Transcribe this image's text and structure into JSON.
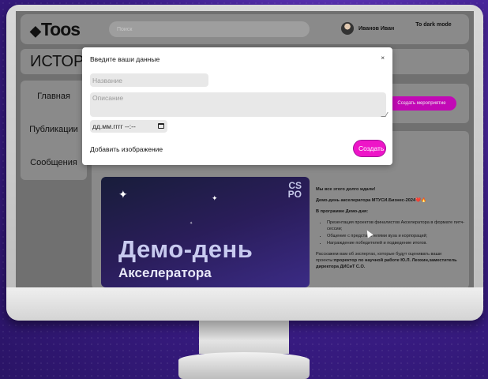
{
  "header": {
    "logo": "Toos",
    "logo_mark": "◆",
    "search_placeholder": "Поиск",
    "user_name": "Иванов Иван",
    "dark_mode_label": "To dark mode"
  },
  "page": {
    "title": "ИСТОРИ"
  },
  "sidebar": {
    "items": [
      {
        "label": "Главная"
      },
      {
        "label": "Публикации"
      },
      {
        "label": "Сообщения"
      }
    ]
  },
  "right_panel": {
    "create_post_label": "Создать мероприятие"
  },
  "post": {
    "image": {
      "corner_mark_line1": "CS",
      "corner_mark_line2": "PO",
      "title": "Демо-день",
      "subtitle": "Акселератора"
    },
    "text": {
      "intro": "Мы все этого долго ждали!",
      "headline": "Демо-день акселератора МТУСИ.Бизнес-2024❤️🔥",
      "program_heading": "В программе Демо-дня:",
      "program_items": [
        "Презентация проектов финалистов Акселератора в формате питч-сессии;",
        "Общение с представителями вуза и корпораций;",
        "Награждение победителей и подведение итогов."
      ],
      "experts_text": "Расскажем вам об экспертах, которые будут оценивать ваши проекты:",
      "expert_bold": "проректор по научной работе Ю.Л. Леохин,заместитель директора ДИСиТ С.О."
    }
  },
  "modal": {
    "title": "Введите ваши данные",
    "close_label": "×",
    "name_placeholder": "Название",
    "description_placeholder": "Описание",
    "date_value": "дд.мм.гггг --:--",
    "add_image_label": "Добавить изображение",
    "submit_label": "Создать"
  },
  "colors": {
    "accent": "#ee15c8",
    "background": "#3d1e8c"
  }
}
